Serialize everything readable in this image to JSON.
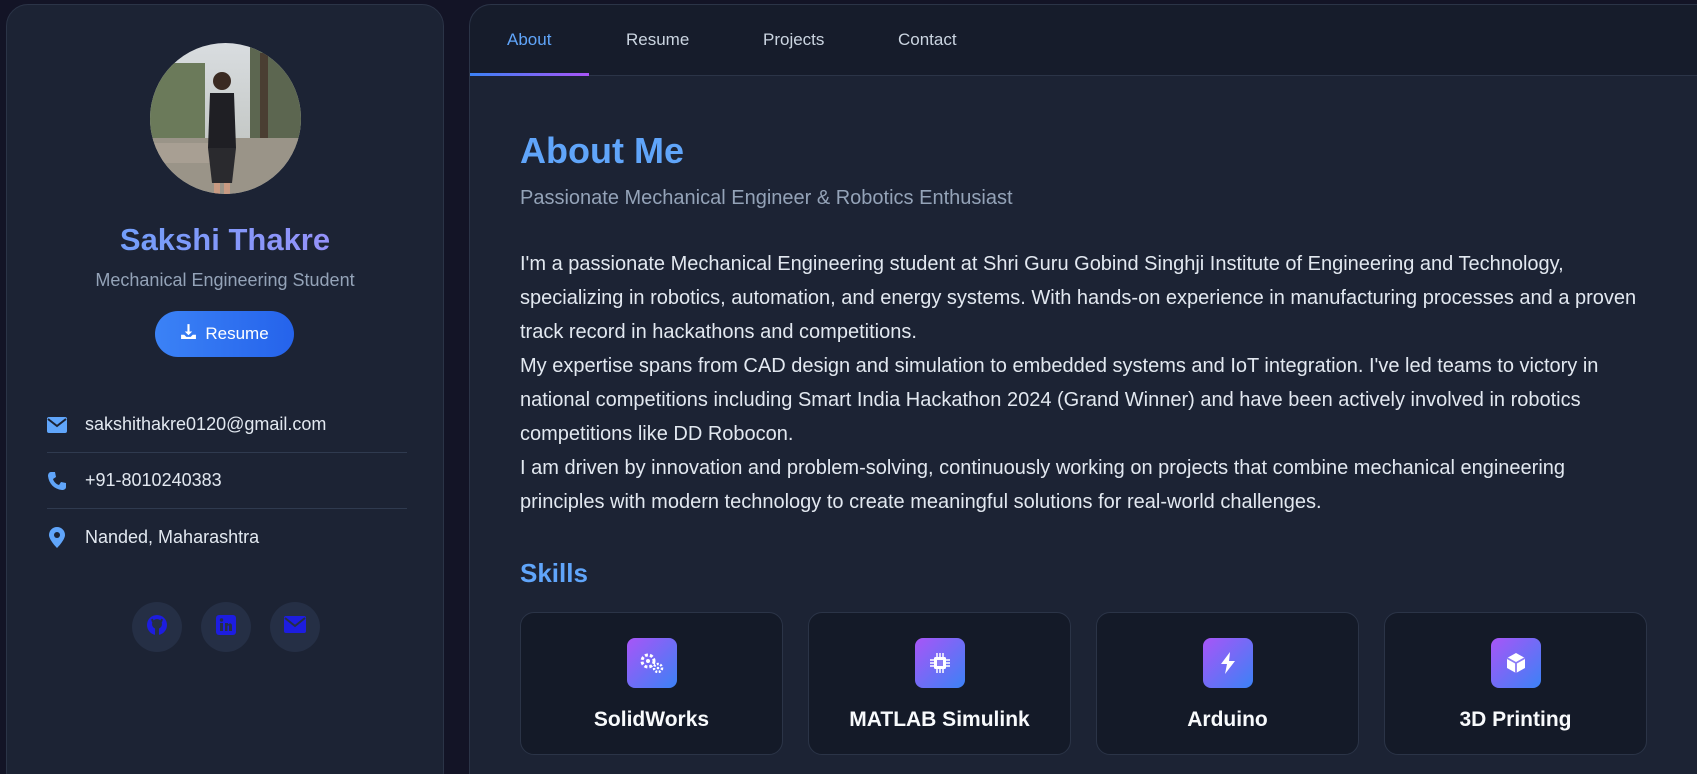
{
  "tabs": [
    {
      "label": "About"
    },
    {
      "label": "Resume"
    },
    {
      "label": "Projects"
    },
    {
      "label": "Contact"
    }
  ],
  "profile": {
    "name": "Sakshi Thakre",
    "role": "Mechanical Engineering Student",
    "resume_button": "Resume"
  },
  "contacts": {
    "email": "sakshithakre0120@gmail.com",
    "phone": "+91-8010240383",
    "location": "Nanded, Maharashtra"
  },
  "socials": [
    {
      "icon": "github-icon"
    },
    {
      "icon": "linkedin-icon"
    },
    {
      "icon": "envelope-icon"
    }
  ],
  "about": {
    "title": "About Me",
    "subtitle": "Passionate Mechanical Engineer & Robotics Enthusiast",
    "paragraphs": [
      "I'm a passionate Mechanical Engineering student at Shri Guru Gobind Singhji Institute of Engineering and Technology, specializing in robotics, automation, and energy systems. With hands-on experience in manufacturing processes and a proven track record in hackathons and competitions.",
      "My expertise spans from CAD design and simulation to embedded systems and IoT integration. I've led teams to victory in national competitions including Smart India Hackathon 2024 (Grand Winner) and have been actively involved in robotics competitions like DD Robocon.",
      "I am driven by innovation and problem-solving, continuously working on projects that combine mechanical engineering principles with modern technology to create meaningful solutions for real-world challenges."
    ]
  },
  "skills": {
    "title": "Skills",
    "items": [
      {
        "label": "SolidWorks",
        "icon": "cogs-icon"
      },
      {
        "label": "MATLAB Simulink",
        "icon": "microchip-icon"
      },
      {
        "label": "Arduino",
        "icon": "bolt-icon"
      },
      {
        "label": "3D Printing",
        "icon": "cube-icon"
      }
    ]
  },
  "colors": {
    "accent": "#60a5fa",
    "background": "#1c2334",
    "gradient_purple": "#a855f7"
  }
}
